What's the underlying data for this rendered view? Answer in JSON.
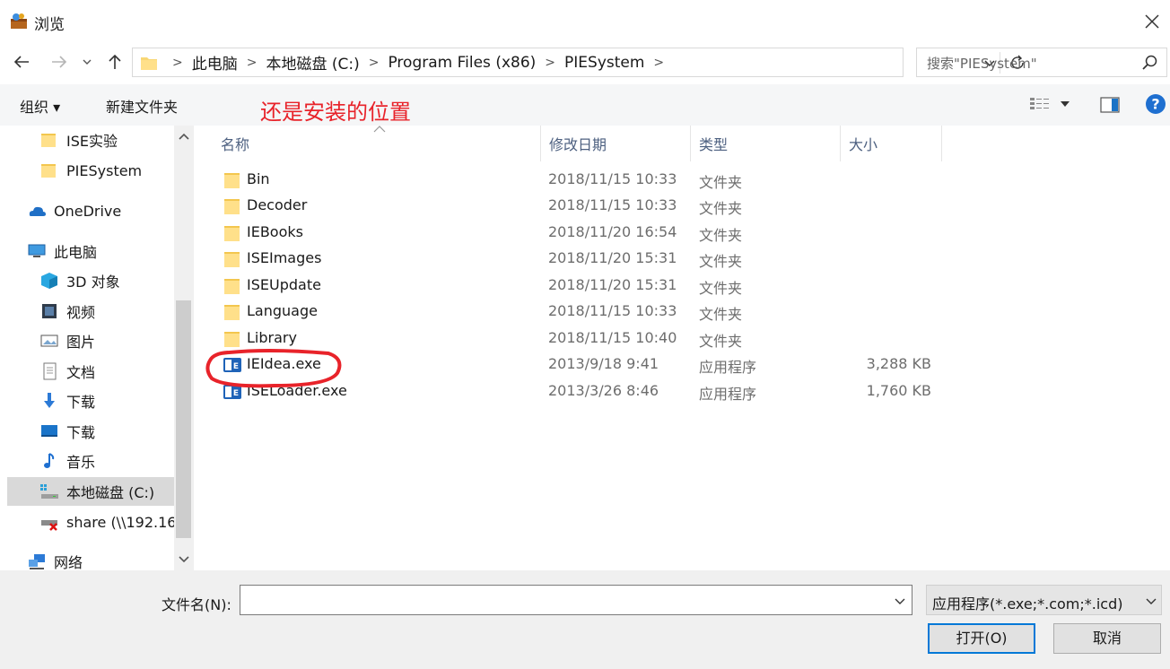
{
  "window": {
    "title": "浏览",
    "icon": "app-icon",
    "close_label": "close-icon"
  },
  "address": {
    "crumbs": [
      "此电脑",
      "本地磁盘 (C:)",
      "Program Files (x86)",
      "PIESystem"
    ],
    "separator": ">",
    "search_placeholder": "搜索\"PIESystem\""
  },
  "toolbar": {
    "organize": "组织 ▾",
    "new_folder": "新建文件夹"
  },
  "annotation": {
    "text": "还是安装的位置",
    "color": "#e8232a"
  },
  "sidebar": {
    "items": [
      {
        "label": "ISE实验",
        "icon": "folder-icon"
      },
      {
        "label": "PIESystem",
        "icon": "folder-icon"
      },
      {
        "label": "OneDrive",
        "icon": "cloud-icon"
      },
      {
        "label": "此电脑",
        "icon": "computer-icon"
      },
      {
        "label": "3D 对象",
        "icon": "cube-icon"
      },
      {
        "label": "视频",
        "icon": "video-icon"
      },
      {
        "label": "图片",
        "icon": "picture-icon"
      },
      {
        "label": "文档",
        "icon": "document-icon"
      },
      {
        "label": "下载",
        "icon": "download-icon"
      },
      {
        "label": "下载",
        "icon": "desktop-icon"
      },
      {
        "label": "音乐",
        "icon": "music-icon"
      },
      {
        "label": "本地磁盘 (C:)",
        "icon": "drive-icon"
      },
      {
        "label": "share (\\\\192.16",
        "icon": "network-drive-icon"
      },
      {
        "label": "网络",
        "icon": "network-icon"
      }
    ]
  },
  "columns": {
    "name": "名称",
    "date": "修改日期",
    "type": "类型",
    "size": "大小"
  },
  "files": [
    {
      "name": "Bin",
      "date": "2018/11/15 10:33",
      "type": "文件夹",
      "size": "",
      "icon": "folder-icon"
    },
    {
      "name": "Decoder",
      "date": "2018/11/15 10:33",
      "type": "文件夹",
      "size": "",
      "icon": "folder-icon"
    },
    {
      "name": "IEBooks",
      "date": "2018/11/20 16:54",
      "type": "文件夹",
      "size": "",
      "icon": "folder-icon"
    },
    {
      "name": "ISEImages",
      "date": "2018/11/20 15:31",
      "type": "文件夹",
      "size": "",
      "icon": "folder-icon"
    },
    {
      "name": "ISEUpdate",
      "date": "2018/11/20 15:31",
      "type": "文件夹",
      "size": "",
      "icon": "folder-icon"
    },
    {
      "name": "Language",
      "date": "2018/11/15 10:33",
      "type": "文件夹",
      "size": "",
      "icon": "folder-icon"
    },
    {
      "name": "Library",
      "date": "2018/11/15 10:40",
      "type": "文件夹",
      "size": "",
      "icon": "folder-icon"
    },
    {
      "name": "IEIdea.exe",
      "date": "2013/9/18 9:41",
      "type": "应用程序",
      "size": "3,288 KB",
      "icon": "exe-icon"
    },
    {
      "name": "ISELoader.exe",
      "date": "2013/3/26 8:46",
      "type": "应用程序",
      "size": "1,760 KB",
      "icon": "exe-icon"
    }
  ],
  "footer": {
    "filename_label": "文件名(N):",
    "filename_value": "",
    "filetype": "应用程序(*.exe;*.com;*.icd)",
    "open": "打开(O)",
    "cancel": "取消"
  }
}
